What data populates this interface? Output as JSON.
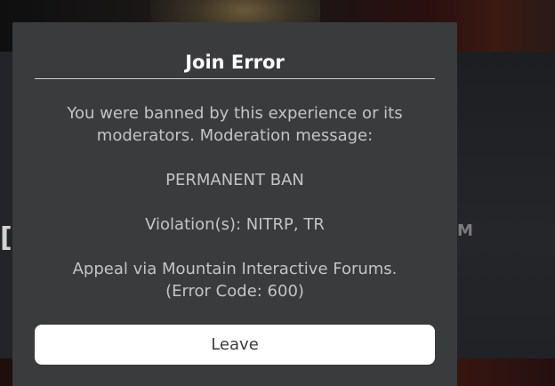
{
  "background": {
    "left_fragment": "[",
    "right_fragment": "M"
  },
  "dialog": {
    "title": "Join Error",
    "message_line_1": "You were banned by this experience or its",
    "message_line_2": "moderators. Moderation message:",
    "ban_type": "PERMANENT BAN",
    "violations": "Violation(s): NITRP, TR",
    "appeal": "Appeal via Mountain Interactive Forums.",
    "error_code": "(Error Code: 600)",
    "leave_label": "Leave"
  },
  "colors": {
    "dialog_background": "#393b3d",
    "title_text": "#ffffff",
    "body_text": "#c3c4c5",
    "button_background": "#ffffff",
    "button_text": "#393b3d"
  }
}
